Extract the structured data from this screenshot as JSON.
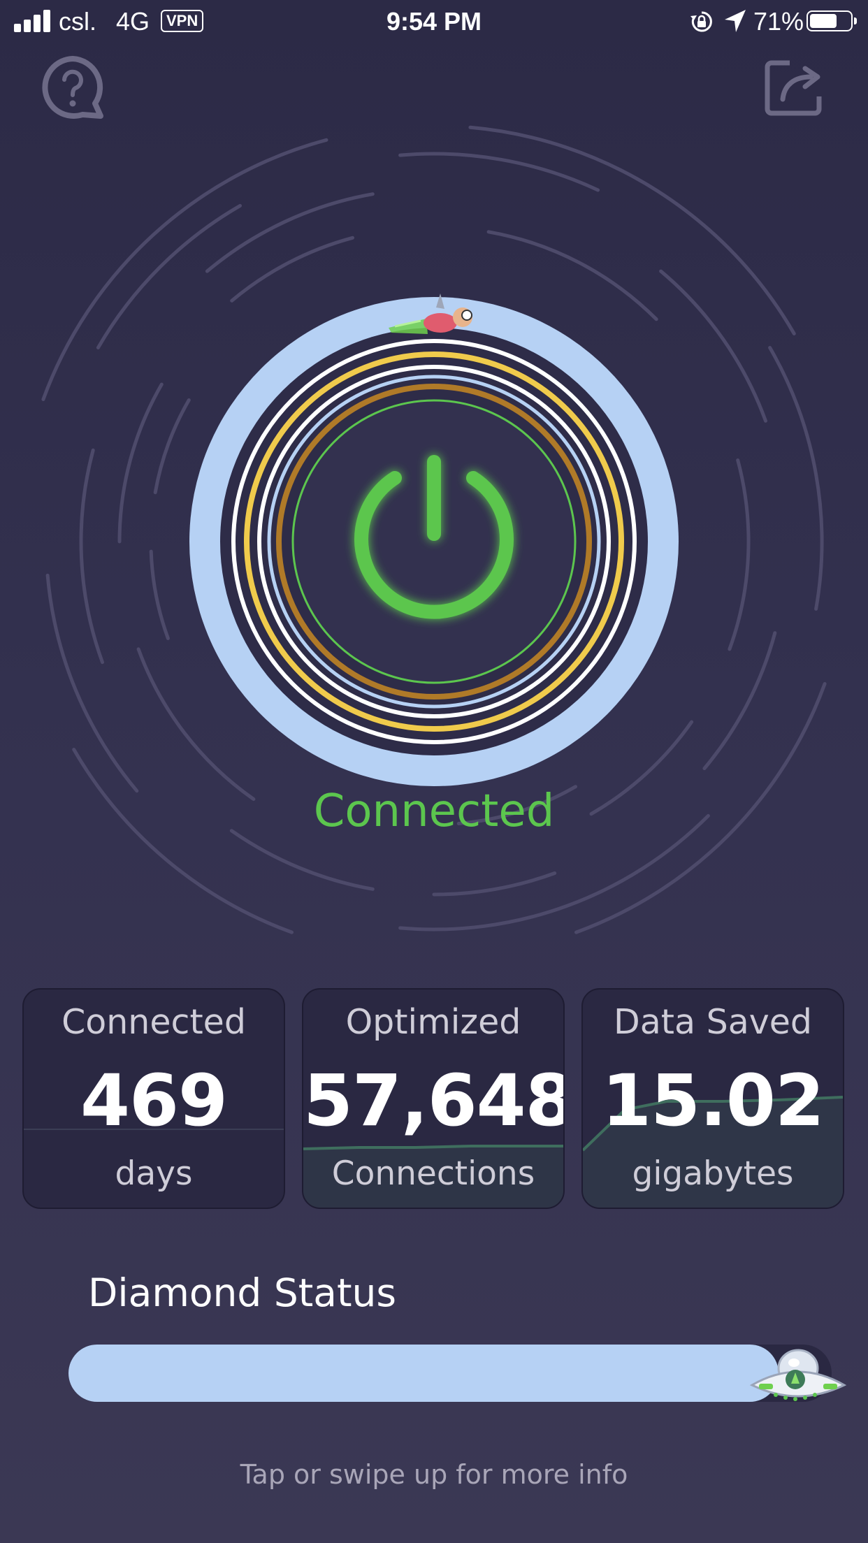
{
  "status_bar": {
    "carrier": "csl.",
    "network": "4G",
    "vpn": "VPN",
    "time": "9:54 PM",
    "battery_percent": "71%",
    "battery_level": 0.71
  },
  "header": {
    "help_icon": "help-bubble-icon",
    "share_icon": "share-icon"
  },
  "connection": {
    "status": "Connected",
    "status_color": "#5cc64e",
    "power_icon": "power-icon"
  },
  "stats": [
    {
      "label": "Connected",
      "value": "469",
      "unit": "days"
    },
    {
      "label": "Optimized",
      "value": "57,648",
      "unit": "Connections"
    },
    {
      "label": "Data Saved",
      "value": "15.02",
      "unit": "gigabytes"
    }
  ],
  "diamond": {
    "title": "Diamond Status",
    "progress": 0.93,
    "progress_color": "#b6d1f4",
    "mascot_icon": "ufo-icon"
  },
  "footer": {
    "hint": "Tap or swipe up for more info"
  },
  "colors": {
    "background": "#2c2a46",
    "card": "#2a2842",
    "accent_green": "#5cc64e",
    "ring_blue": "#b6d1f4",
    "ring_gold": "#f0cb4c",
    "ring_bronze": "#b07a28"
  }
}
